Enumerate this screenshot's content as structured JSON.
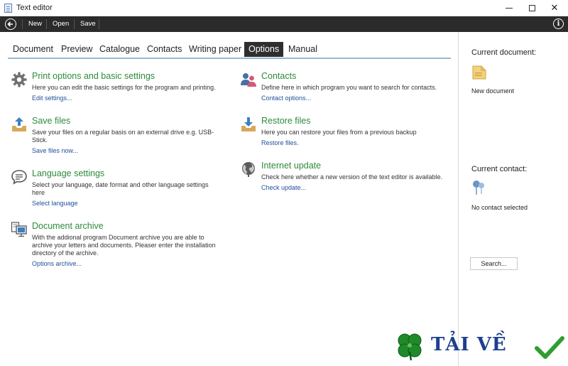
{
  "window": {
    "title": "Text editor",
    "controls": {
      "minimize": "–",
      "maximize": "□",
      "close": "✕"
    }
  },
  "toolbar": {
    "back_icon": "back-arrow-icon",
    "new_label": "New",
    "open_label": "Open",
    "save_label": "Save",
    "info_glyph": "i"
  },
  "tabs": [
    {
      "label": "Document",
      "active": false
    },
    {
      "label": "Preview",
      "active": false
    },
    {
      "label": "Catalogue",
      "active": false
    },
    {
      "label": "Contacts",
      "active": false
    },
    {
      "label": "Writing paper",
      "active": false
    },
    {
      "label": "Options",
      "active": true
    },
    {
      "label": "Manual",
      "active": false
    }
  ],
  "sections_left": [
    {
      "icon": "gear-icon",
      "title": "Print options and basic settings",
      "description": "Here you can edit the basic settings for the program and printing.",
      "link": "Edit settings..."
    },
    {
      "icon": "upload-tray-icon",
      "title": "Save files",
      "description": "Save your files on a regular basis on an external drive e.g. USB-Stick.",
      "link": "Save files now..."
    },
    {
      "icon": "speech-bubble-icon",
      "title": "Language settings",
      "description": "Select your language, date format and other language settings here",
      "link": "Select language"
    },
    {
      "icon": "archive-monitor-icon",
      "title": "Document archive",
      "description": "With the addional program Document archive you are able to archive your letters and documents. Pleaser enter the installation directory of the archive.",
      "link": "Options archive..."
    }
  ],
  "sections_right": [
    {
      "icon": "people-icon",
      "title": "Contacts",
      "description": "Define here in which program you want to search for contacts.",
      "link": "Contact options..."
    },
    {
      "icon": "download-tray-icon",
      "title": "Restore files",
      "description": "Here you can restore your files from a previous backup",
      "link": "Restore files."
    },
    {
      "icon": "globe-icon",
      "title": "Internet update",
      "description": "Check here whether a new version of the text editor is available.",
      "link": "Check update..."
    }
  ],
  "right_panel": {
    "current_document_label": "Current document:",
    "current_document_value": "New document",
    "current_contact_label": "Current contact:",
    "current_contact_value": "No contact selected",
    "search_button": "Search..."
  },
  "watermark": {
    "text": "TẢI VỀ",
    "logo_icon": "clover-icon",
    "check_icon": "checkmark-icon"
  },
  "colors": {
    "section_title": "#2e8b3a",
    "link": "#1f4f99",
    "toolbar_bg": "#2b2b2b",
    "active_tab_bg": "#2e2e2e",
    "tab_underline": "#9ab7d0"
  }
}
